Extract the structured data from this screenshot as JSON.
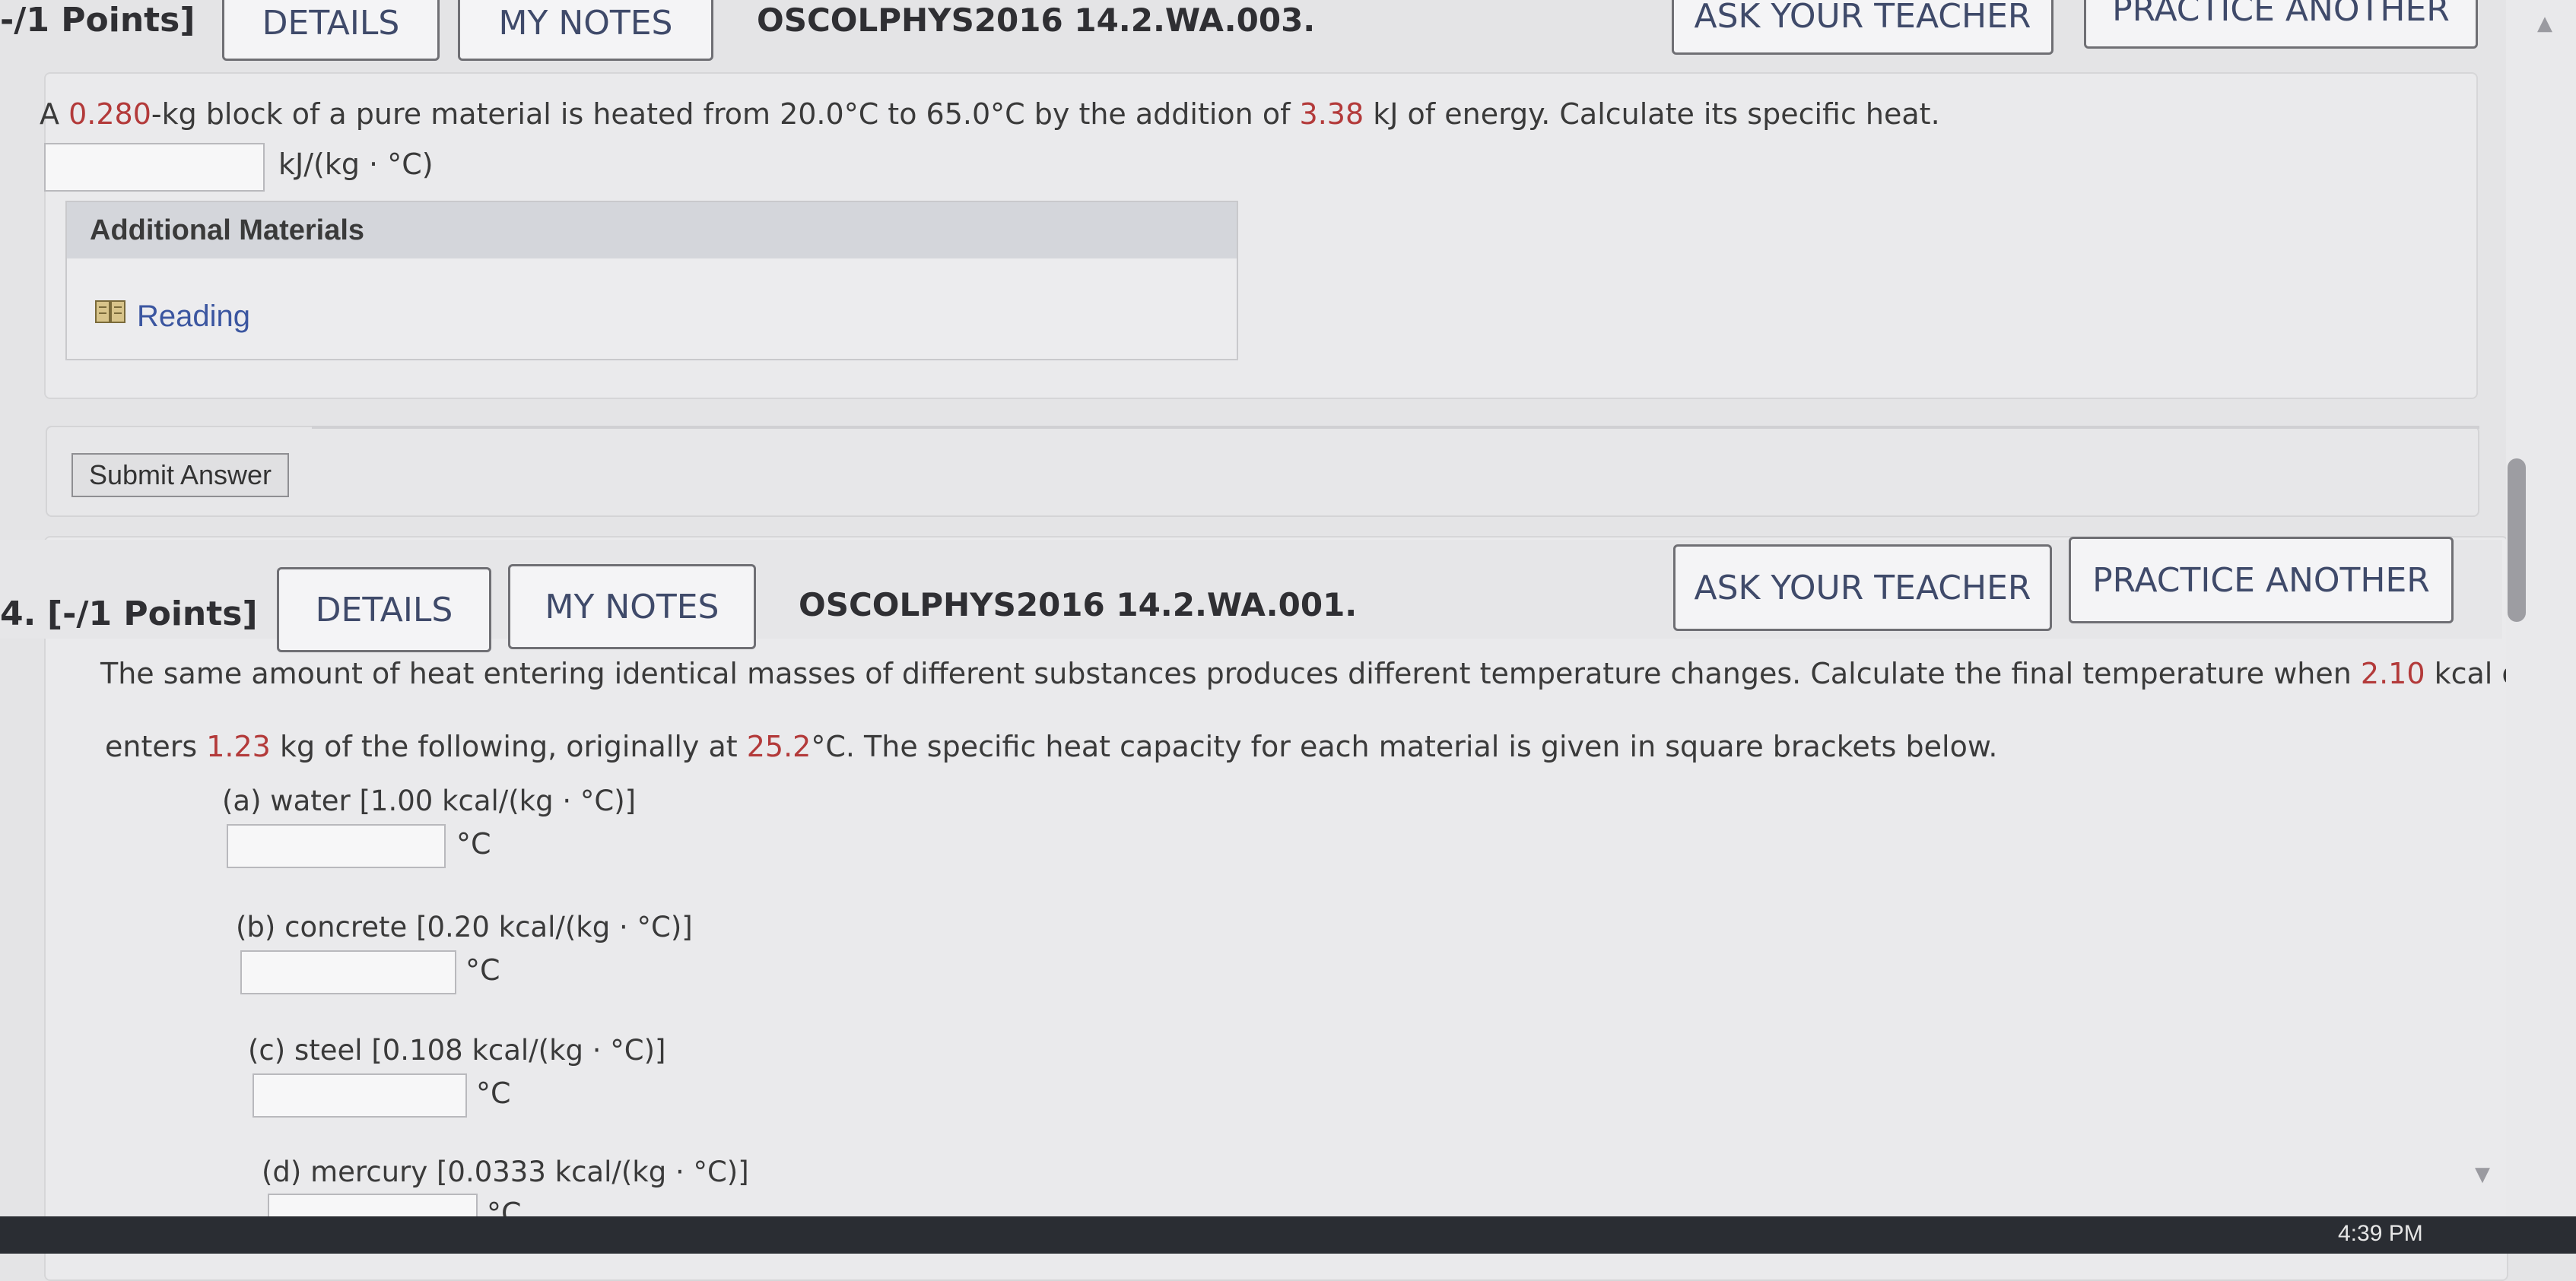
{
  "q3": {
    "points": "-/1 Points]",
    "details_label": "DETAILS",
    "notes_label": "MY NOTES",
    "code": "OSCOLPHYS2016 14.2.WA.003.",
    "ask_label": "ASK YOUR TEACHER",
    "practice_label": "PRACTICE ANOTHER",
    "text_a": "A ",
    "mass": "0.280",
    "text_b": "-kg block of a pure material is heated from 20.0°C to 65.0°C by the addition of ",
    "energy": "3.38",
    "text_c": " kJ of energy. Calculate its specific heat.",
    "unit": "kJ/(kg · °C)",
    "answer_value": "",
    "additional_materials": "Additional Materials",
    "reading_label": "Reading",
    "submit_label": "Submit Answer"
  },
  "q4": {
    "number": "4.",
    "points": "[-/1 Points]",
    "details_label": "DETAILS",
    "notes_label": "MY NOTES",
    "code": "OSCOLPHYS2016 14.2.WA.001.",
    "ask_label": "ASK YOUR TEACHER",
    "practice_label": "PRACTICE ANOTHER",
    "line1_a": "The same amount of heat entering identical masses of different substances produces different temperature changes. Calculate the final temperature when ",
    "heat": "2.10",
    "line1_b": " kcal of heat",
    "line2_a": "enters ",
    "mass": "1.23",
    "line2_b": " kg of the following, originally at ",
    "temp": "25.2",
    "line2_c": "°C. The specific heat capacity for each material is given in square brackets below.",
    "parts": [
      {
        "label": "(a) water [1.00 kcal/(kg · °C)]",
        "unit": "°C",
        "value": ""
      },
      {
        "label": "(b) concrete [0.20 kcal/(kg · °C)]",
        "unit": "°C",
        "value": ""
      },
      {
        "label": "(c) steel [0.108 kcal/(kg · °C)]",
        "unit": "°C",
        "value": ""
      },
      {
        "label": "(d) mercury [0.0333 kcal/(kg · °C)]",
        "unit": "°C",
        "value": ""
      }
    ]
  },
  "system": {
    "clock": "4:39 PM"
  },
  "colors": {
    "highlight_red": "#b33a3a",
    "link_blue": "#3b56a0",
    "button_border": "#6f6f74"
  },
  "icons": {
    "reading": "book-icon",
    "scroll_up": "triangle-up-icon",
    "scroll_down": "triangle-down-icon"
  }
}
